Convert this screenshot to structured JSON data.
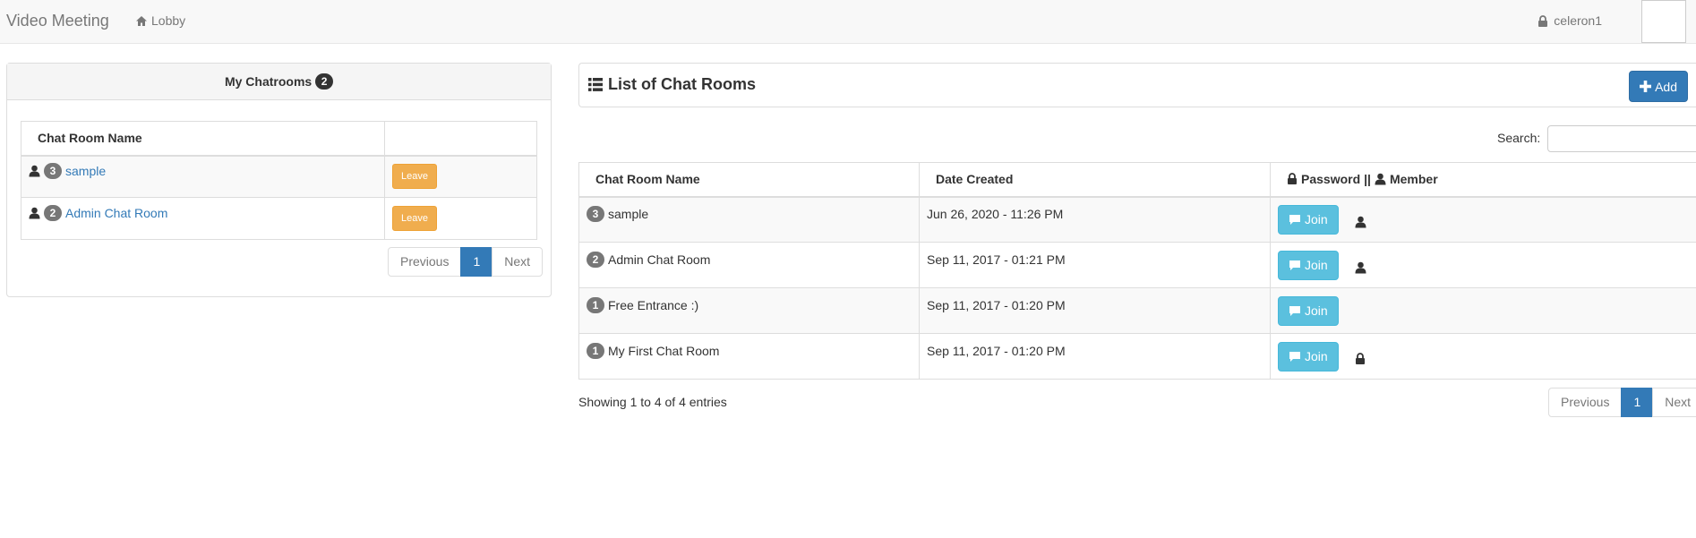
{
  "navbar": {
    "brand": "Video Meeting",
    "lobby_label": "Lobby",
    "username": "celeron1"
  },
  "my_chatrooms": {
    "title": "My Chatrooms",
    "count": "2",
    "column_name": "Chat Room Name",
    "rows": [
      {
        "members": "3",
        "name": "sample",
        "action": "Leave"
      },
      {
        "members": "2",
        "name": "Admin Chat Room",
        "action": "Leave"
      }
    ],
    "pagination": {
      "previous": "Previous",
      "page": "1",
      "next": "Next"
    }
  },
  "room_list": {
    "title": "List of Chat Rooms",
    "add_label": "Add",
    "search_label": "Search:",
    "search_value": "",
    "columns": {
      "name": "Chat Room Name",
      "date": "Date Created",
      "password": "Password",
      "separator": "||",
      "member": "Member"
    },
    "rows": [
      {
        "members": "3",
        "name": "sample",
        "date": "Jun 26, 2020 - 11:26 PM",
        "join": "Join",
        "status_icon": "user-icon"
      },
      {
        "members": "2",
        "name": "Admin Chat Room",
        "date": "Sep 11, 2017 - 01:21 PM",
        "join": "Join",
        "status_icon": "user-icon"
      },
      {
        "members": "1",
        "name": "Free Entrance :)",
        "date": "Sep 11, 2017 - 01:20 PM",
        "join": "Join",
        "status_icon": ""
      },
      {
        "members": "1",
        "name": "My First Chat Room",
        "date": "Sep 11, 2017 - 01:20 PM",
        "join": "Join",
        "status_icon": "lock-icon"
      }
    ],
    "showing_text": "Showing 1 to 4 of 4 entries",
    "pagination": {
      "previous": "Previous",
      "page": "1",
      "next": "Next"
    }
  },
  "colors": {
    "primary": "#337ab7",
    "warning": "#f0ad4e",
    "info": "#5bc0de",
    "badge": "#777777"
  }
}
